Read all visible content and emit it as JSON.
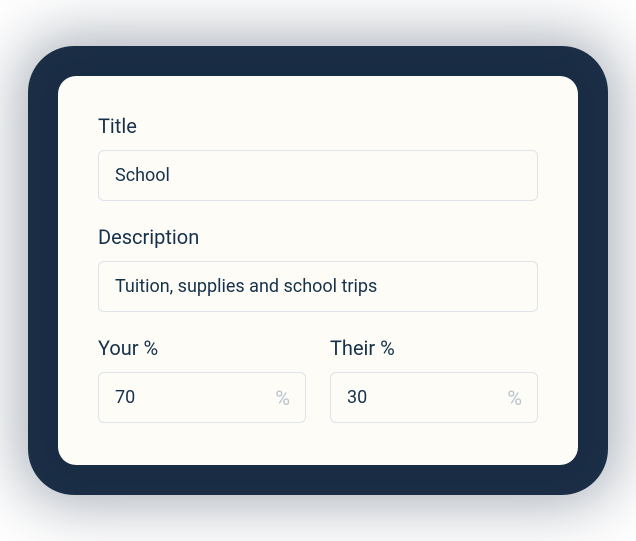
{
  "form": {
    "title": {
      "label": "Title",
      "value": "School"
    },
    "description": {
      "label": "Description",
      "value": "Tuition, supplies and school trips"
    },
    "yourPercent": {
      "label": "Your %",
      "value": "70",
      "suffix": "%"
    },
    "theirPercent": {
      "label": "Their %",
      "value": "30",
      "suffix": "%"
    }
  }
}
